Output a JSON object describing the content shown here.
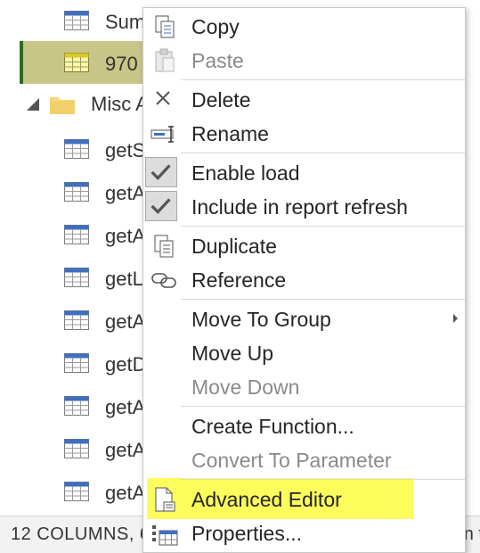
{
  "queries_pane": {
    "top_items": [
      {
        "name": "Sum",
        "selected": false
      },
      {
        "name": "970",
        "selected": true
      }
    ],
    "folder": {
      "name": "Misc A"
    },
    "folder_items": [
      "getS",
      "getA",
      "getA",
      "getL",
      "getA",
      "getD",
      "getA",
      "getA",
      "getA"
    ]
  },
  "context_menu": {
    "copy": "Copy",
    "paste": "Paste",
    "delete": "Delete",
    "rename": "Rename",
    "enable_load": "Enable load",
    "include_refresh": "Include in report refresh",
    "duplicate": "Duplicate",
    "reference": "Reference",
    "move_to_group": "Move To Group",
    "move_up": "Move Up",
    "move_down": "Move Down",
    "create_function": "Create Function...",
    "convert_to_parameter": "Convert To Parameter",
    "advanced_editor": "Advanced Editor",
    "properties": "Properties..."
  },
  "status_bar": {
    "left": "12 COLUMNS, 6",
    "right": "n t"
  },
  "colors": {
    "selection_bg": "#c8c588",
    "selection_bar": "#2f6b1f",
    "highlight": "#fcfc5c",
    "table_icon_header": "#3f6fbf",
    "folder": "#f6d77c"
  }
}
